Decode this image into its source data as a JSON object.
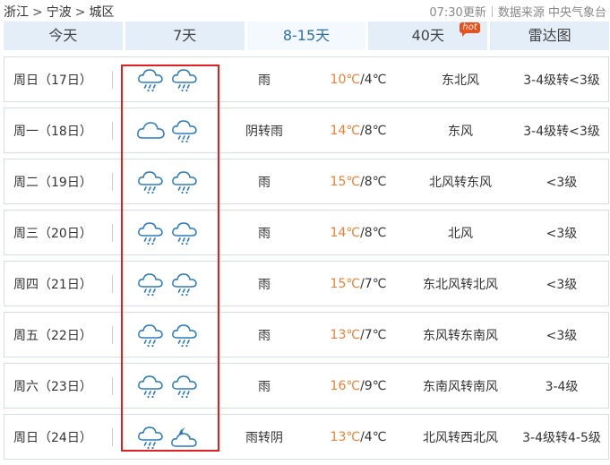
{
  "breadcrumb": [
    "浙江",
    "宁波",
    "城区"
  ],
  "update_time": "07:30更新",
  "source_label": "数据来源",
  "source_name": "中央气象台",
  "tabs": [
    {
      "label": "今天"
    },
    {
      "label": "7天"
    },
    {
      "label": "8-15天"
    },
    {
      "label": "40天",
      "badge": "hot"
    },
    {
      "label": "雷达图"
    }
  ],
  "active_tab": "8-15天",
  "colors": {
    "hi_temp": "#ef7f31",
    "active_tab_text": "#2a6fb0",
    "tab_bg": "#e3eef8",
    "highlight_box": "#e02020",
    "icon_stroke": "#2b7bc0"
  },
  "forecast": [
    {
      "date": "周日（17日）",
      "icons": [
        "rain-cloud-icon",
        "rain-cloud-icon"
      ],
      "weather": "雨",
      "high": "10℃",
      "low": "/4℃",
      "wind": "东北风",
      "level": "3-4级转<3级"
    },
    {
      "date": "周一（18日）",
      "icons": [
        "cloud-icon",
        "rain-cloud-icon"
      ],
      "weather": "阴转雨",
      "high": "14℃",
      "low": "/8℃",
      "wind": "东风",
      "level": "3-4级转<3级"
    },
    {
      "date": "周二（19日）",
      "icons": [
        "rain-cloud-icon",
        "rain-cloud-icon"
      ],
      "weather": "雨",
      "high": "15℃",
      "low": "/8℃",
      "wind": "北风转东风",
      "level": "<3级"
    },
    {
      "date": "周三（20日）",
      "icons": [
        "rain-cloud-icon",
        "rain-cloud-icon"
      ],
      "weather": "雨",
      "high": "14℃",
      "low": "/8℃",
      "wind": "北风",
      "level": "<3级"
    },
    {
      "date": "周四（21日）",
      "icons": [
        "rain-cloud-icon",
        "rain-cloud-icon"
      ],
      "weather": "雨",
      "high": "15℃",
      "low": "/7℃",
      "wind": "东北风转北风",
      "level": "<3级"
    },
    {
      "date": "周五（22日）",
      "icons": [
        "rain-cloud-icon",
        "rain-cloud-icon"
      ],
      "weather": "雨",
      "high": "13℃",
      "low": "/7℃",
      "wind": "东风转东南风",
      "level": "<3级"
    },
    {
      "date": "周六（23日）",
      "icons": [
        "rain-cloud-icon",
        "rain-cloud-icon"
      ],
      "weather": "雨",
      "high": "16℃",
      "low": "/9℃",
      "wind": "东南风转南风",
      "level": "3-4级"
    },
    {
      "date": "周日（24日）",
      "icons": [
        "rain-cloud-icon",
        "cloudy-night-icon"
      ],
      "weather": "雨转阴",
      "high": "13℃",
      "low": "/4℃",
      "wind": "北风转西北风",
      "level": "3-4级转4-5级"
    }
  ]
}
